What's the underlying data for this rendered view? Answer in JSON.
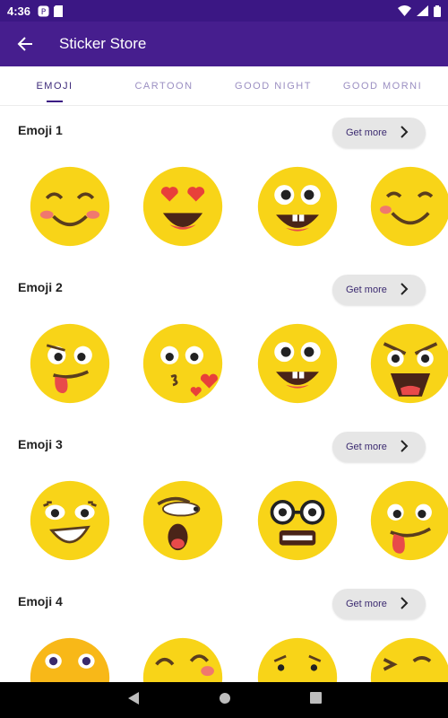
{
  "status_bar": {
    "time": "4:36",
    "icons_left": [
      "notification-icon",
      "sim-icon"
    ],
    "icons_right": [
      "wifi-icon",
      "signal-icon",
      "battery-icon"
    ]
  },
  "app_bar": {
    "title": "Sticker Store",
    "back_icon": "back-arrow-icon",
    "color": "#461e8e"
  },
  "tabs": [
    {
      "label": "EMOJI",
      "active": true
    },
    {
      "label": "CARTOON",
      "active": false
    },
    {
      "label": "GOOD NIGHT",
      "active": false
    },
    {
      "label": "GOOD MORNI",
      "active": false
    }
  ],
  "sections": [
    {
      "title": "Emoji 1",
      "button": "Get more",
      "stickers": [
        "blushing-smile",
        "heart-eyes",
        "goofy-grin",
        "winking-smile"
      ]
    },
    {
      "title": "Emoji 2",
      "button": "Get more",
      "stickers": [
        "tongue-out-wink",
        "kissing-heart",
        "goofy-grin",
        "angry-shout"
      ]
    },
    {
      "title": "Emoji 3",
      "button": "Get more",
      "stickers": [
        "lash-grin",
        "yawning",
        "nerd-grimace",
        "tongue-out"
      ]
    },
    {
      "title": "Emoji 4",
      "button": "Get more",
      "stickers": [
        "wide-eyes",
        "happy-closed-eyes",
        "worried",
        "laughing"
      ]
    }
  ],
  "colors": {
    "status_bar": "#3b1784",
    "accent": "#3b1784",
    "emoji_yellow": "#f8d418",
    "button_bg": "#e6e6e6"
  },
  "nav_bar": [
    "back-triangle-icon",
    "home-circle-icon",
    "recents-square-icon"
  ]
}
